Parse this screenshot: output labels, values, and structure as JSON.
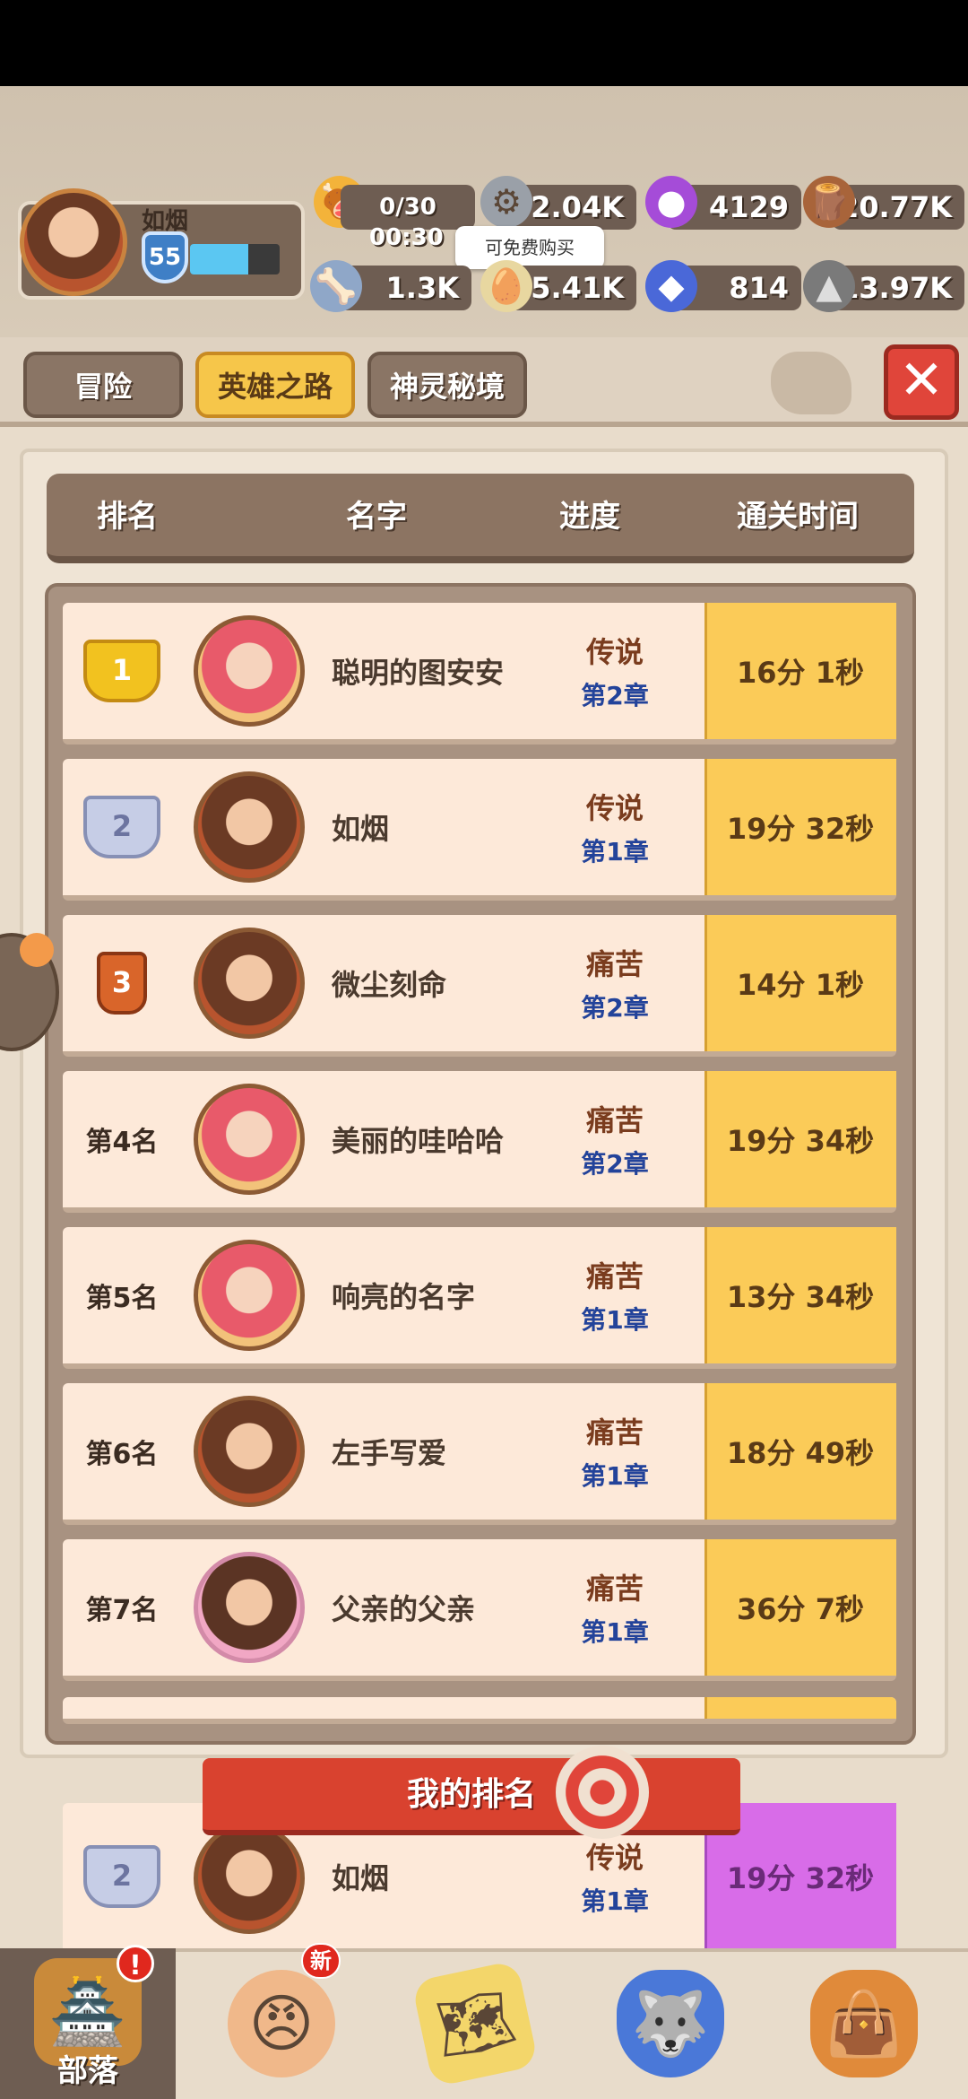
{
  "player": {
    "name": "如烟",
    "level": "55",
    "xp_fraction": 0.65
  },
  "resources": {
    "meat": {
      "value": "0/30",
      "timer": "00:30",
      "icon": "meat-icon"
    },
    "nut": {
      "value": "2.04K",
      "icon": "nut-icon"
    },
    "potion": {
      "value": "4129",
      "icon": "potion-icon"
    },
    "wood": {
      "value": "20.77K",
      "icon": "wood-icon"
    },
    "bone": {
      "value": "1.3K",
      "icon": "bone-icon"
    },
    "egg": {
      "value": "5.41K",
      "icon": "egg-icon"
    },
    "gem": {
      "value": "814",
      "icon": "gem-icon"
    },
    "stone": {
      "value": "13.97K",
      "icon": "stone-icon"
    },
    "free_tip": "可免费购买"
  },
  "tabs": [
    {
      "label": "冒险"
    },
    {
      "label": "英雄之路"
    },
    {
      "label": "神灵秘境"
    }
  ],
  "table": {
    "headers": [
      "排名",
      "名字",
      "进度",
      "通关时间"
    ],
    "rows": [
      {
        "rank": "1",
        "rank_style": "gold",
        "avatar": "girl",
        "name": "聪明的图安安",
        "difficulty": "传说",
        "chapter": "第2章",
        "time": "16分 1秒"
      },
      {
        "rank": "2",
        "rank_style": "silver",
        "avatar": "boy",
        "name": "如烟",
        "difficulty": "传说",
        "chapter": "第1章",
        "time": "19分 32秒"
      },
      {
        "rank": "3",
        "rank_style": "bronze",
        "avatar": "boy",
        "name": "微尘刻命",
        "difficulty": "痛苦",
        "chapter": "第2章",
        "time": "14分 1秒"
      },
      {
        "rank": "第4名",
        "rank_style": "text",
        "avatar": "girl",
        "name": "美丽的哇哈哈",
        "difficulty": "痛苦",
        "chapter": "第2章",
        "time": "19分 34秒"
      },
      {
        "rank": "第5名",
        "rank_style": "text",
        "avatar": "girl",
        "name": "响亮的名字",
        "difficulty": "痛苦",
        "chapter": "第1章",
        "time": "13分 34秒"
      },
      {
        "rank": "第6名",
        "rank_style": "text",
        "avatar": "boy",
        "name": "左手写爱",
        "difficulty": "痛苦",
        "chapter": "第1章",
        "time": "18分 49秒"
      },
      {
        "rank": "第7名",
        "rank_style": "text",
        "avatar": "plain",
        "name": "父亲的父亲",
        "difficulty": "痛苦",
        "chapter": "第1章",
        "time": "36分 7秒"
      }
    ]
  },
  "my_rank": {
    "banner": "我的排名",
    "rank": "2",
    "name": "如烟",
    "difficulty": "传说",
    "chapter": "第1章",
    "time": "19分 32秒"
  },
  "bottom_nav": [
    {
      "label": "部落",
      "icon": "tribe-icon",
      "badge": "!"
    },
    {
      "label": "",
      "icon": "hero-icon",
      "badge": "新"
    },
    {
      "label": "",
      "icon": "map-icon",
      "badge": ""
    },
    {
      "label": "",
      "icon": "pet-icon",
      "badge": ""
    },
    {
      "label": "",
      "icon": "bag-icon",
      "badge": ""
    }
  ],
  "colors": {
    "time_cell": "#fbcb58",
    "my_time_cell": "#d86ce8",
    "active_tab": "#f6c64a",
    "close": "#e0453a"
  }
}
